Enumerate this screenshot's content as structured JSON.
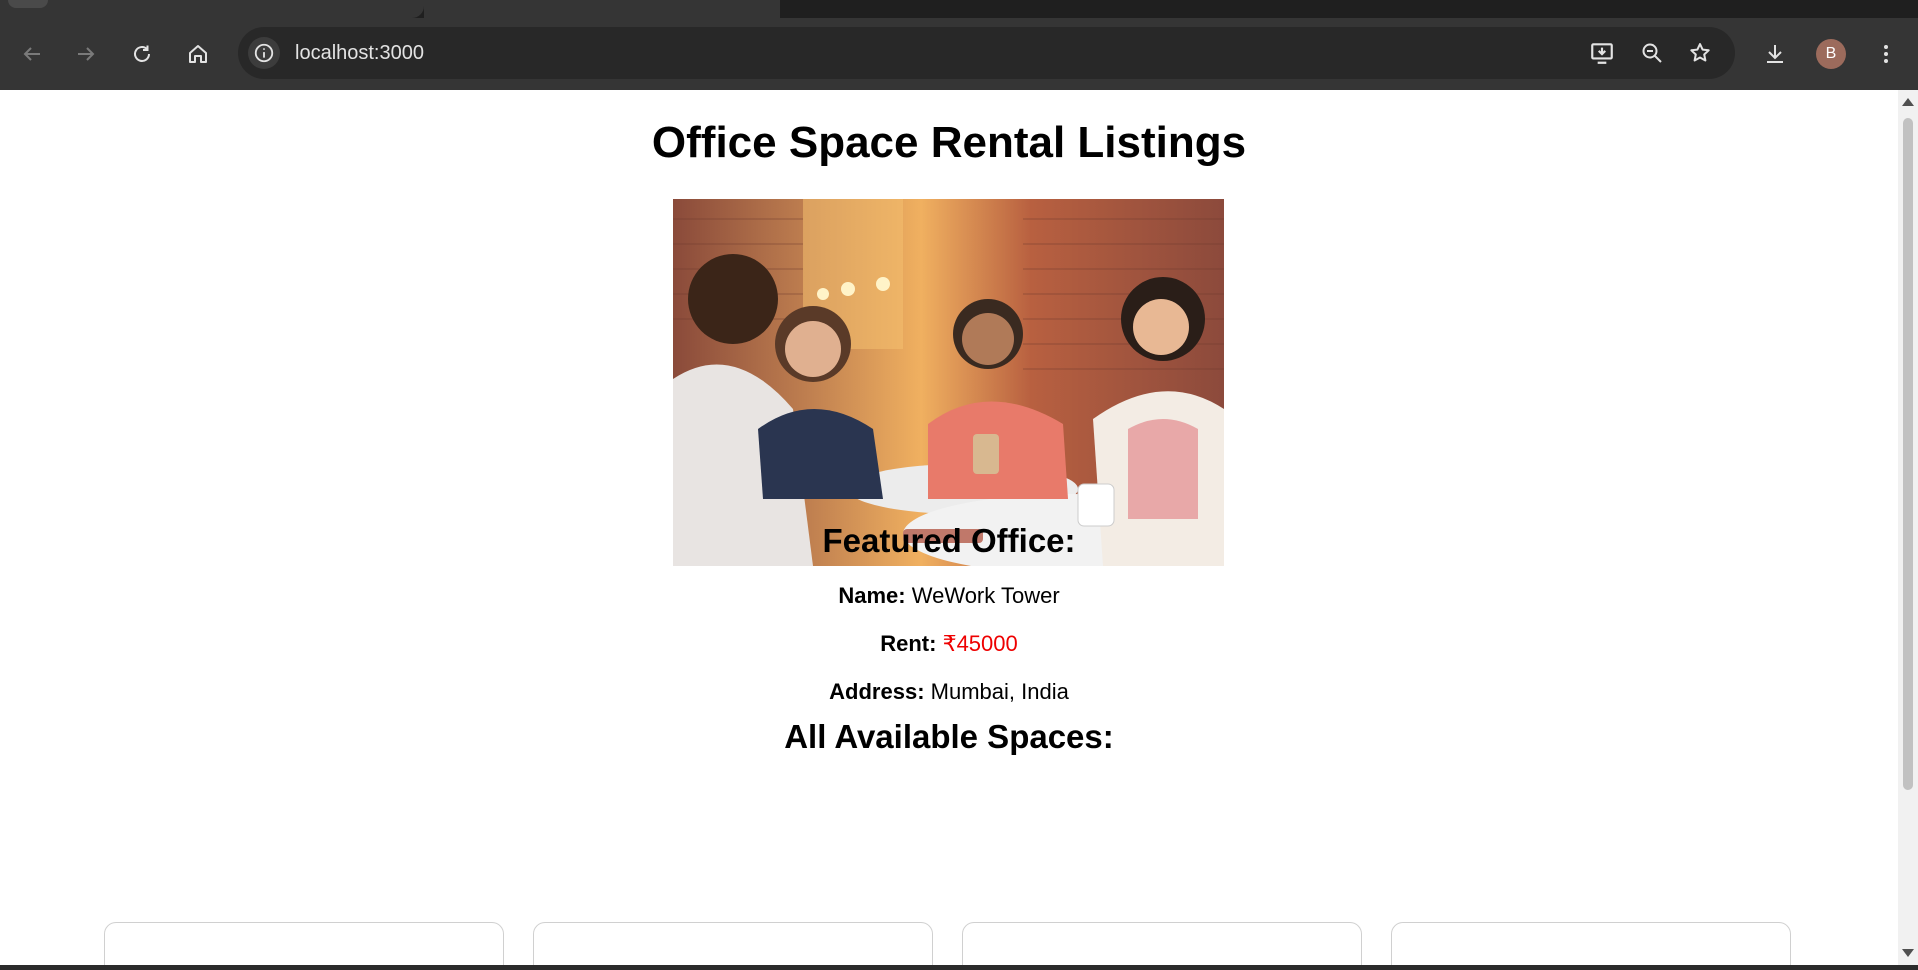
{
  "browser": {
    "url": "localhost:3000",
    "avatar_letter": "B"
  },
  "page": {
    "title": "Office Space Rental Listings",
    "hero_image_alt": "Four women talking at a cafe table",
    "featured_heading": "Featured Office:",
    "featured": {
      "name_label": "Name:",
      "name_value": "WeWork Tower",
      "rent_label": "Rent:",
      "rent_value": "₹45000",
      "address_label": "Address:",
      "address_value": "Mumbai, India"
    },
    "all_heading": "All Available Spaces:",
    "card_count": 4
  },
  "colors": {
    "rent": "#ee0000",
    "chrome_toolbar": "#353535",
    "omnibox": "#282828",
    "avatar": "#9c6b5c"
  }
}
